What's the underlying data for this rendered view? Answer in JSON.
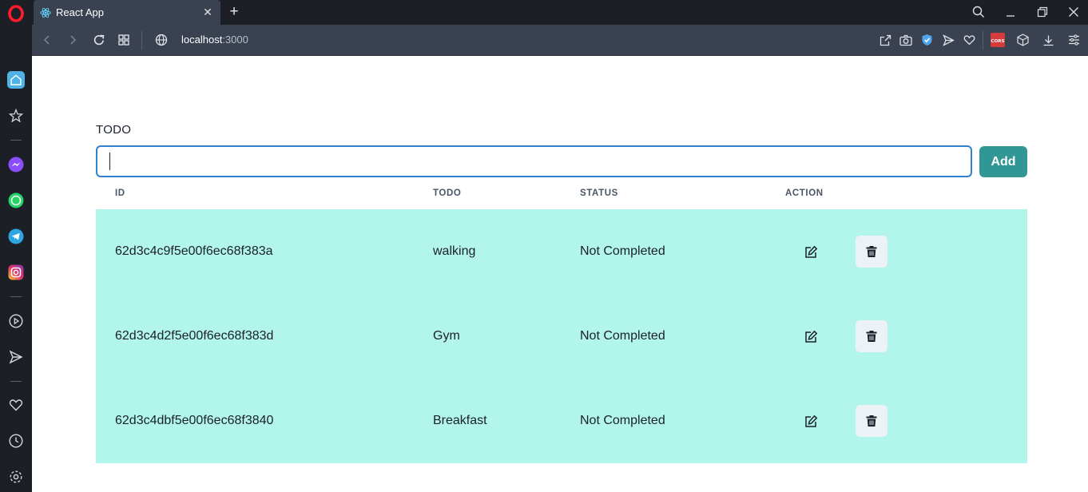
{
  "browser": {
    "tab_title": "React App",
    "url_host": "localhost",
    "url_port": ":3000",
    "ext_badge": "CORS"
  },
  "colors": {
    "accent": "#319795",
    "input_border": "#3182ce",
    "row_bg": "#b2f5ea",
    "sidebar_bg": "#1c1f26",
    "toolbar_bg": "#3a4150"
  },
  "form": {
    "label": "TODO",
    "input_value": "",
    "add_label": "Add"
  },
  "table": {
    "headers": [
      "ID",
      "TODO",
      "STATUS",
      "ACTION"
    ],
    "rows": [
      {
        "id": "62d3c4c9f5e00f6ec68f383a",
        "todo": "walking",
        "status": "Not Completed"
      },
      {
        "id": "62d3c4d2f5e00f6ec68f383d",
        "todo": "Gym",
        "status": "Not Completed"
      },
      {
        "id": "62d3c4dbf5e00f6ec68f3840",
        "todo": "Breakfast",
        "status": "Not Completed"
      }
    ]
  }
}
